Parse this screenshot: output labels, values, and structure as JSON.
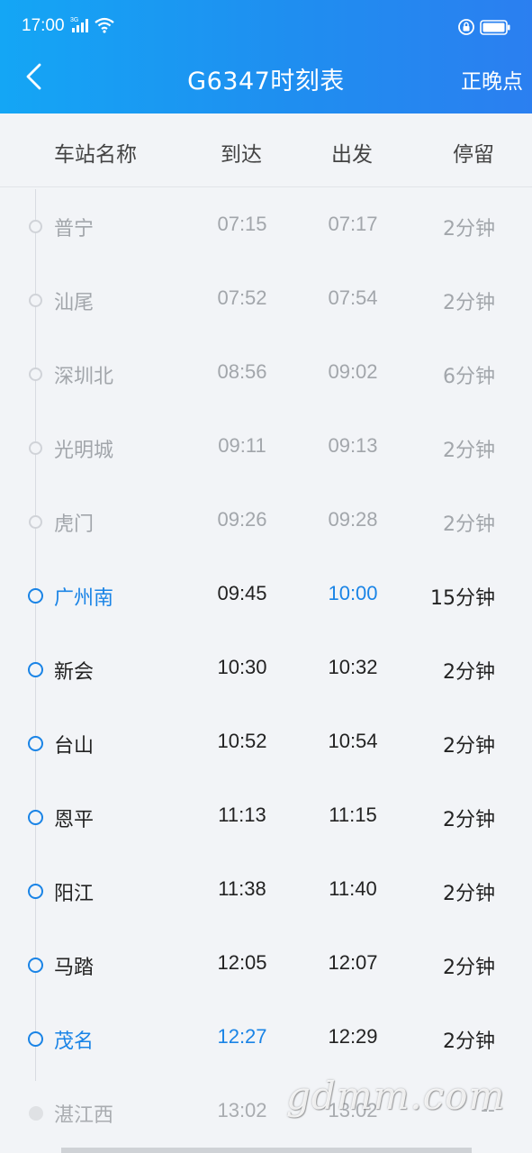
{
  "status": {
    "time": "17:00",
    "network": "3G"
  },
  "nav": {
    "title": "G6347时刻表",
    "right_label": "正晚点"
  },
  "columns": {
    "station": "车站名称",
    "arrive": "到达",
    "depart": "出发",
    "stop": "停留"
  },
  "stations": [
    {
      "name": "普宁",
      "arrive": "07:15",
      "depart": "07:17",
      "stop": "2分钟",
      "state": "past"
    },
    {
      "name": "汕尾",
      "arrive": "07:52",
      "depart": "07:54",
      "stop": "2分钟",
      "state": "past"
    },
    {
      "name": "深圳北",
      "arrive": "08:56",
      "depart": "09:02",
      "stop": "6分钟",
      "state": "past"
    },
    {
      "name": "光明城",
      "arrive": "09:11",
      "depart": "09:13",
      "stop": "2分钟",
      "state": "past"
    },
    {
      "name": "虎门",
      "arrive": "09:26",
      "depart": "09:28",
      "stop": "2分钟",
      "state": "past"
    },
    {
      "name": "广州南",
      "arrive": "09:45",
      "depart": "10:00",
      "stop": "15分钟",
      "state": "future",
      "highlight": [
        "name",
        "depart"
      ]
    },
    {
      "name": "新会",
      "arrive": "10:30",
      "depart": "10:32",
      "stop": "2分钟",
      "state": "future"
    },
    {
      "name": "台山",
      "arrive": "10:52",
      "depart": "10:54",
      "stop": "2分钟",
      "state": "future"
    },
    {
      "name": "恩平",
      "arrive": "11:13",
      "depart": "11:15",
      "stop": "2分钟",
      "state": "future"
    },
    {
      "name": "阳江",
      "arrive": "11:38",
      "depart": "11:40",
      "stop": "2分钟",
      "state": "future"
    },
    {
      "name": "马踏",
      "arrive": "12:05",
      "depart": "12:07",
      "stop": "2分钟",
      "state": "future"
    },
    {
      "name": "茂名",
      "arrive": "12:27",
      "depart": "12:29",
      "stop": "2分钟",
      "state": "future",
      "highlight": [
        "name",
        "arrive"
      ]
    },
    {
      "name": "湛江西",
      "arrive": "13:02",
      "depart": "13:02",
      "stop": "--",
      "state": "final"
    }
  ],
  "watermark": "gdmm.com",
  "colors": {
    "header": "#1f8ef0",
    "accent": "#1a84e6",
    "past_text": "#a2a6ab"
  },
  "icons": [
    "back-arrow-icon",
    "signal-icon",
    "wifi-icon",
    "lock-icon",
    "battery-icon"
  ]
}
